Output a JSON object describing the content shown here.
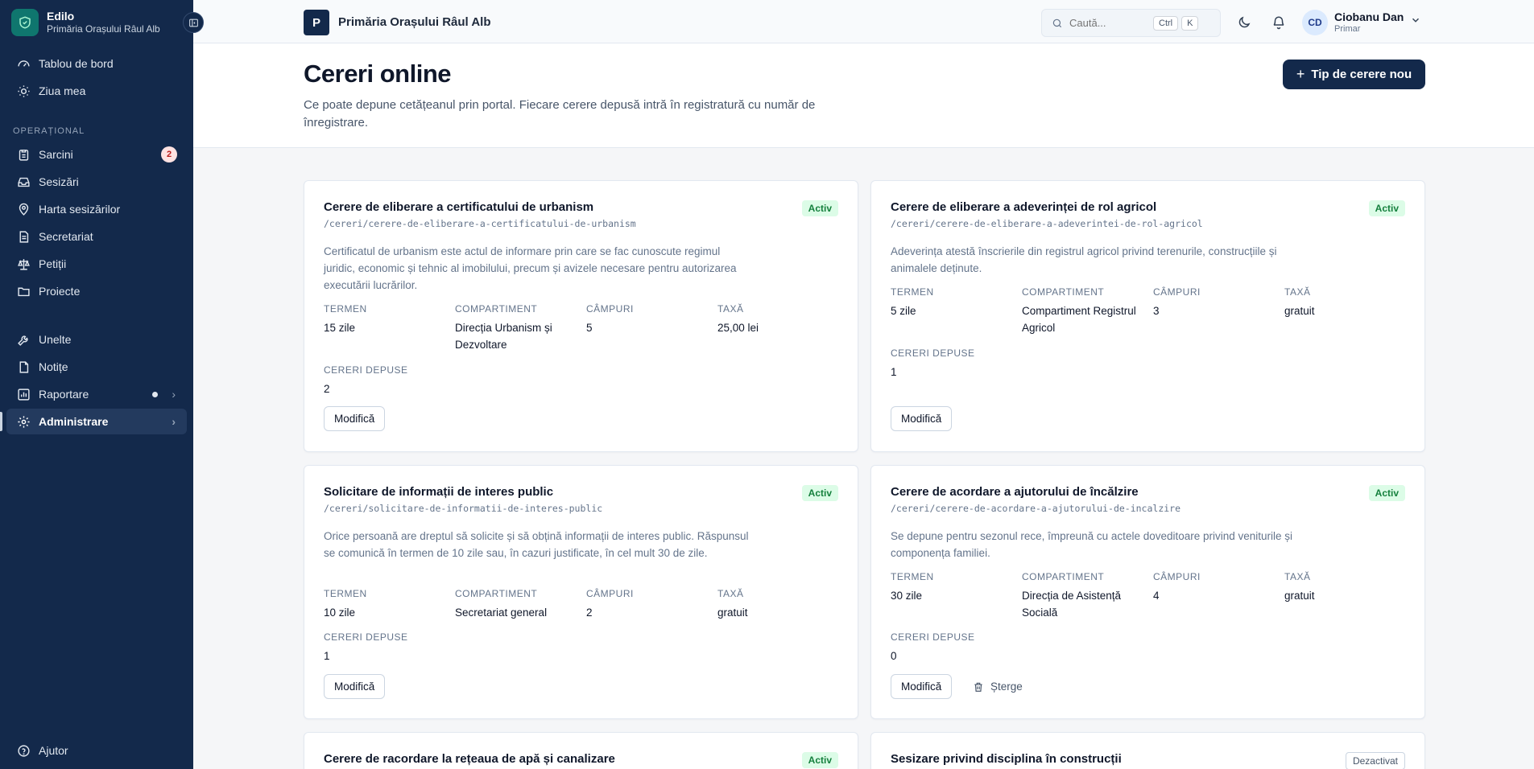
{
  "brand": {
    "name": "Edilo",
    "subtitle": "Primăria Orașului Râul Alb"
  },
  "sidebar": {
    "top_items": [
      {
        "label": "Tablou de bord",
        "icon": "gauge-icon"
      },
      {
        "label": "Ziua mea",
        "icon": "sun-icon"
      }
    ],
    "section_label": "OPERAȚIONAL",
    "ops_items": [
      {
        "label": "Sarcini",
        "icon": "clipboard-icon",
        "badge": "2"
      },
      {
        "label": "Sesizări",
        "icon": "inbox-icon"
      },
      {
        "label": "Harta sesizărilor",
        "icon": "map-pin-icon"
      },
      {
        "label": "Secretariat",
        "icon": "document-icon"
      },
      {
        "label": "Petiții",
        "icon": "scale-icon"
      },
      {
        "label": "Proiecte",
        "icon": "folder-icon"
      }
    ],
    "tool_items": [
      {
        "label": "Unelte",
        "icon": "wrench-icon"
      },
      {
        "label": "Notițe",
        "icon": "note-icon"
      },
      {
        "label": "Raportare",
        "icon": "chart-icon"
      },
      {
        "label": "Administrare",
        "icon": "gear-icon"
      }
    ],
    "help_label": "Ajutor"
  },
  "topbar": {
    "org_initial": "P",
    "org_name": "Primăria Orașului Râul Alb",
    "search_placeholder": "Caută...",
    "kbd_ctrl": "Ctrl",
    "kbd_k": "K",
    "user_initials": "CD",
    "user_name": "Ciobanu Dan",
    "user_role": "Primar"
  },
  "header": {
    "title": "Cereri online",
    "description": "Ce poate depune cetățeanul prin portal. Fiecare cerere depusă intră în registratură cu număr de înregistrare.",
    "new_button": "Tip de cerere nou"
  },
  "labels": {
    "termen": "TERMEN",
    "compartiment": "COMPARTIMENT",
    "campuri": "CÂMPURI",
    "taxa": "TAXĂ",
    "cereri_depuse": "CERERI DEPUSE",
    "edit": "Modifică",
    "delete": "Șterge"
  },
  "cards": [
    {
      "title": "Cerere de eliberare a certificatului de urbanism",
      "path": "/cereri/cerere-de-eliberare-a-certificatului-de-urbanism",
      "status": "Activ",
      "description": "Certificatul de urbanism este actul de informare prin care se fac cunoscute regimul juridic, economic și tehnic al imobilului, precum și avizele necesare pentru autorizarea executării lucrărilor.",
      "termen": "15 zile",
      "compartiment": "Direcția Urbanism și Dezvoltare",
      "campuri": "5",
      "taxa": "25,00 lei",
      "cereri_depuse": "2"
    },
    {
      "title": "Cerere de eliberare a adeverinței de rol agricol",
      "path": "/cereri/cerere-de-eliberare-a-adeverintei-de-rol-agricol",
      "status": "Activ",
      "description": "Adeverința atestă înscrierile din registrul agricol privind terenurile, construcțiile și animalele deținute.",
      "termen": "5 zile",
      "compartiment": "Compartiment Registrul Agricol",
      "campuri": "3",
      "taxa": "gratuit",
      "cereri_depuse": "1"
    },
    {
      "title": "Solicitare de informații de interes public",
      "path": "/cereri/solicitare-de-informatii-de-interes-public",
      "status": "Activ",
      "description": "Orice persoană are dreptul să solicite și să obțină informații de interes public. Răspunsul se comunică în termen de 10 zile sau, în cazuri justificate, în cel mult 30 de zile.",
      "termen": "10 zile",
      "compartiment": "Secretariat general",
      "campuri": "2",
      "taxa": "gratuit",
      "cereri_depuse": "1"
    },
    {
      "title": "Cerere de acordare a ajutorului de încălzire",
      "path": "/cereri/cerere-de-acordare-a-ajutorului-de-incalzire",
      "status": "Activ",
      "description": "Se depune pentru sezonul rece, împreună cu actele doveditoare privind veniturile și componența familiei.",
      "termen": "30 zile",
      "compartiment": "Direcția de Asistență Socială",
      "campuri": "4",
      "taxa": "gratuit",
      "cereri_depuse": "0"
    },
    {
      "title": "Cerere de racordare la rețeaua de apă și canalizare",
      "status": "Activ"
    },
    {
      "title": "Sesizare privind disciplina în construcții",
      "status": "Dezactivat"
    }
  ],
  "colors": {
    "sidebar": "#13294b",
    "primary": "#13294b",
    "active_green": "#15803d"
  }
}
